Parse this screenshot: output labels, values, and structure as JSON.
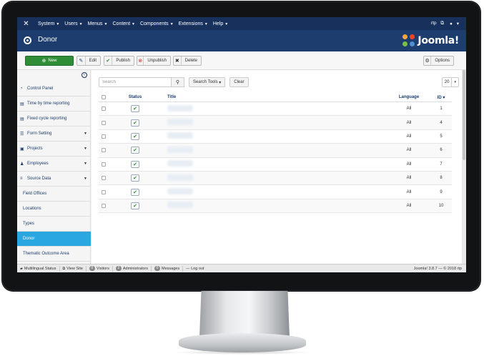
{
  "topbar": {
    "menu": [
      {
        "label": "System"
      },
      {
        "label": "Users"
      },
      {
        "label": "Menus"
      },
      {
        "label": "Content"
      },
      {
        "label": "Components"
      },
      {
        "label": "Extensions"
      },
      {
        "label": "Help"
      }
    ],
    "site_label": "rtp",
    "user_icon": "user-icon"
  },
  "titlebar": {
    "page_title": "Donor",
    "brand_name": "Joomla!"
  },
  "toolbar": {
    "new_label": "New",
    "edit_label": "Edit",
    "publish_label": "Publish",
    "unpublish_label": "Unpublish",
    "delete_label": "Delete",
    "options_label": "Options"
  },
  "sidebar": {
    "items": [
      {
        "label": "Control Panel",
        "icon": "dashboard-icon"
      },
      {
        "label": "Time by time reporting",
        "icon": "document-icon"
      },
      {
        "label": "Fixed cycle reporting",
        "icon": "document-icon"
      },
      {
        "label": "Form Setting",
        "icon": "list-icon"
      },
      {
        "label": "Projects",
        "icon": "clipboard-icon"
      },
      {
        "label": "Employees",
        "icon": "users-icon"
      },
      {
        "label": "Source Data",
        "icon": "database-icon"
      }
    ],
    "sub_items": [
      {
        "label": "Field Offices"
      },
      {
        "label": "Locations"
      },
      {
        "label": "Types"
      },
      {
        "label": "Donor"
      },
      {
        "label": "Thematic Outcome Area"
      }
    ]
  },
  "filters": {
    "search_placeholder": "Search",
    "search_tools_label": "Search Tools",
    "clear_label": "Clear",
    "limit_value": "20"
  },
  "table": {
    "headers": {
      "status": "Status",
      "title": "Title",
      "language": "Language",
      "id": "ID"
    },
    "rows": [
      {
        "language": "All",
        "id": "1"
      },
      {
        "language": "All",
        "id": "4"
      },
      {
        "language": "All",
        "id": "5"
      },
      {
        "language": "All",
        "id": "6"
      },
      {
        "language": "All",
        "id": "7"
      },
      {
        "language": "All",
        "id": "8"
      },
      {
        "language": "All",
        "id": "9"
      },
      {
        "language": "All",
        "id": "10"
      }
    ]
  },
  "statusbar": {
    "multilingual": "Multilingual Status",
    "view_site": "View Site",
    "visitors_count": "0",
    "visitors_label": "Visitors",
    "admins_count": "2",
    "admins_label": "Administrators",
    "messages_count": "0",
    "messages_label": "Messages",
    "logout_label": "Log out",
    "version": "Joomla! 3.8.7 — © 2018 rtp"
  },
  "colors": {
    "topbar": "#17305c",
    "titlebar": "#1c3d6e",
    "new_button": "#2f8c37",
    "active_item": "#2aa7e0"
  }
}
